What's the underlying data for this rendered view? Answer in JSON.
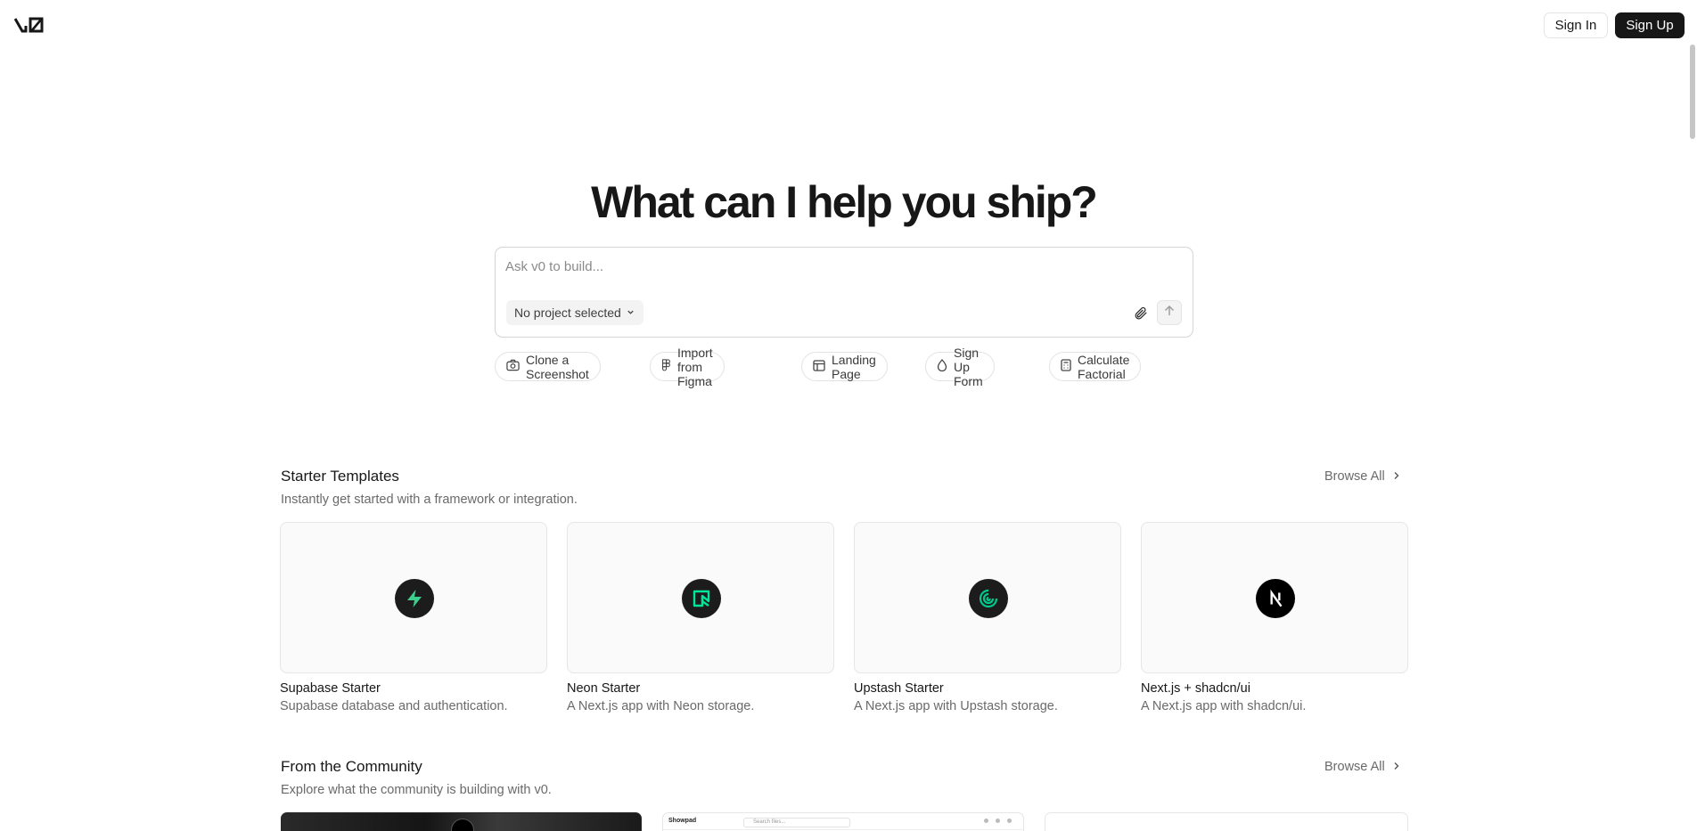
{
  "header": {
    "logo": "v0-logo",
    "sign_in": "Sign In",
    "sign_up": "Sign Up"
  },
  "hero": {
    "title": "What can I help you ship?",
    "prompt_placeholder": "Ask v0 to build...",
    "project_select": "No project selected",
    "icons": {
      "attach": "paperclip-icon",
      "send": "arrow-up-icon",
      "dropdown": "chevron-down-icon"
    }
  },
  "chips": [
    {
      "label": "Clone a Screenshot",
      "icon": "camera-icon"
    },
    {
      "label": "Import from Figma",
      "icon": "figma-icon"
    },
    {
      "label": "Landing Page",
      "icon": "layout-icon"
    },
    {
      "label": "Sign Up Form",
      "icon": "droplet-icon"
    },
    {
      "label": "Calculate Factorial",
      "icon": "calculator-icon"
    }
  ],
  "starter": {
    "title": "Starter Templates",
    "subtitle": "Instantly get started with a framework or integration.",
    "browse": "Browse All",
    "cards": [
      {
        "name": "Supabase Starter",
        "desc": "Supabase database and authentication.",
        "icon": "supabase-icon"
      },
      {
        "name": "Neon Starter",
        "desc": "A Next.js app with Neon storage.",
        "icon": "neon-icon"
      },
      {
        "name": "Upstash Starter",
        "desc": "A Next.js app with Upstash storage.",
        "icon": "upstash-icon"
      },
      {
        "name": "Next.js + shadcn/ui",
        "desc": "A Next.js app with shadcn/ui.",
        "icon": "nextjs-icon"
      }
    ]
  },
  "community": {
    "title": "From the Community",
    "subtitle": "Explore what the community is building with v0.",
    "browse": "Browse All",
    "preview_b_app": "Showpad",
    "preview_b_search": "Search files..."
  },
  "colors": {
    "text": "#171717",
    "muted": "#6a6a6a",
    "border": "#e5e5e5",
    "supabase_green": "#3ecf8e",
    "neon_green": "#00e599",
    "upstash_green": "#00c98d"
  }
}
